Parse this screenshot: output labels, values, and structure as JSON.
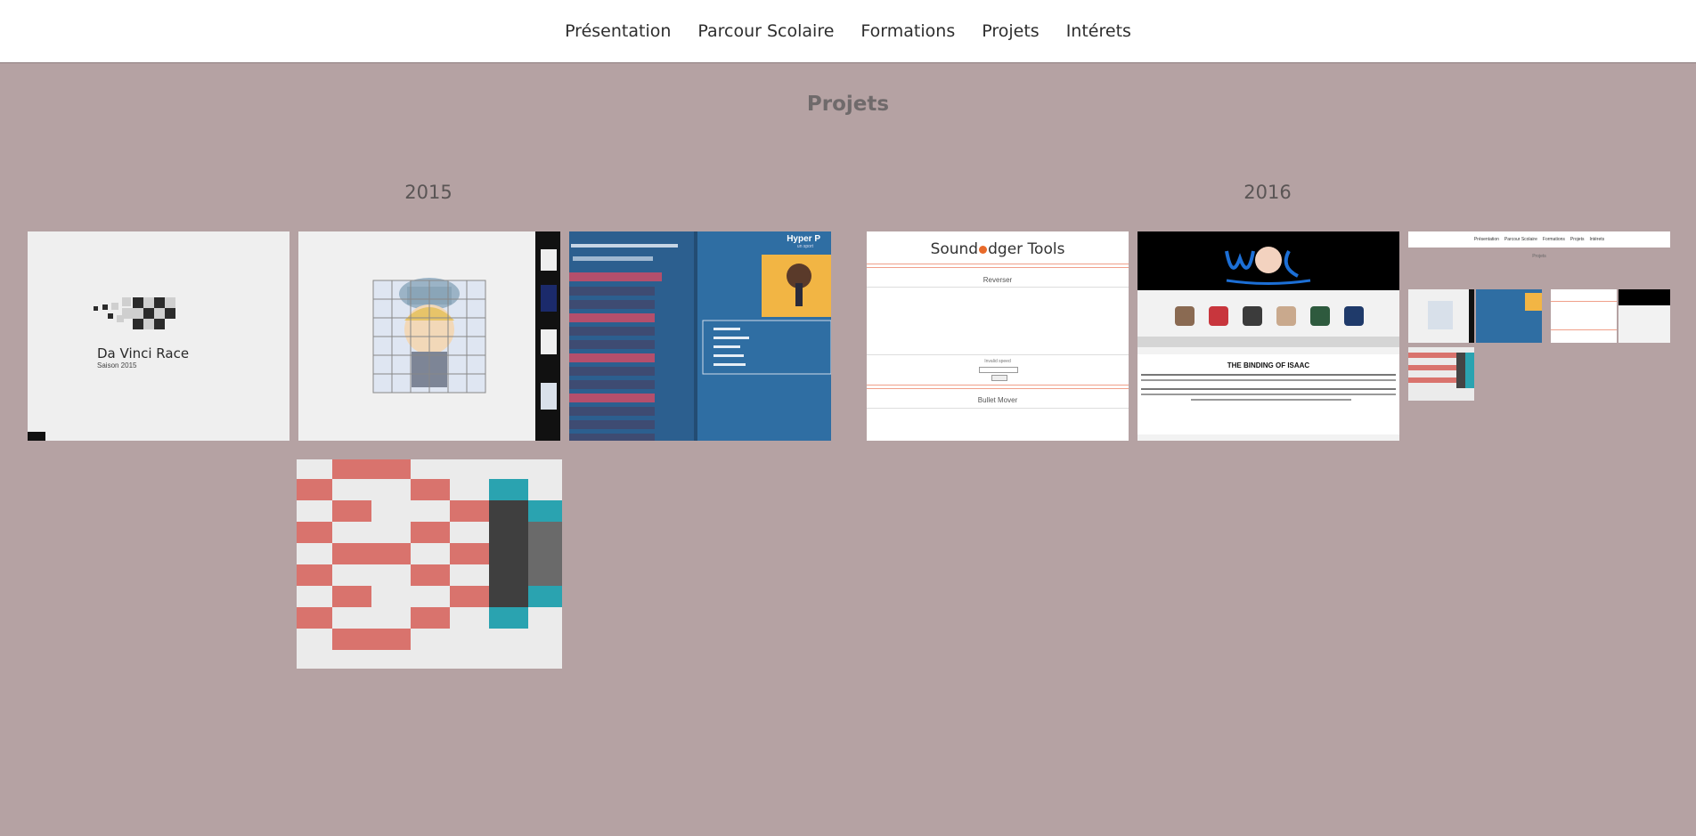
{
  "nav": {
    "items": [
      "Présentation",
      "Parcour Scolaire",
      "Formations",
      "Projets",
      "Intérets"
    ]
  },
  "page": {
    "title": "Projets"
  },
  "years": {
    "first": "2015",
    "second": "2016"
  },
  "projects": {
    "davinci": {
      "title": "Da Vinci Race",
      "subtitle": "Saison 2015"
    },
    "hyper": {
      "heading": "Hyper P",
      "sub": "un sport"
    },
    "soundodger": {
      "title_pre": "Sound",
      "title_post": "dger Tools",
      "section1": "Reverser",
      "section2": "Bullet Mover",
      "field": "Invalid speed"
    },
    "isaac": {
      "title": "THE BINDING OF ISAAC"
    }
  },
  "mini_nav": [
    "Présentation",
    "Parcour Scolaire",
    "Formations",
    "Projets",
    "Intérets"
  ],
  "mini_title": "Projets",
  "colors": {
    "background": "#b5a2a3",
    "accent_red": "#d9736d",
    "teal": "#2aa3b0",
    "blue": "#2f6ea3"
  }
}
